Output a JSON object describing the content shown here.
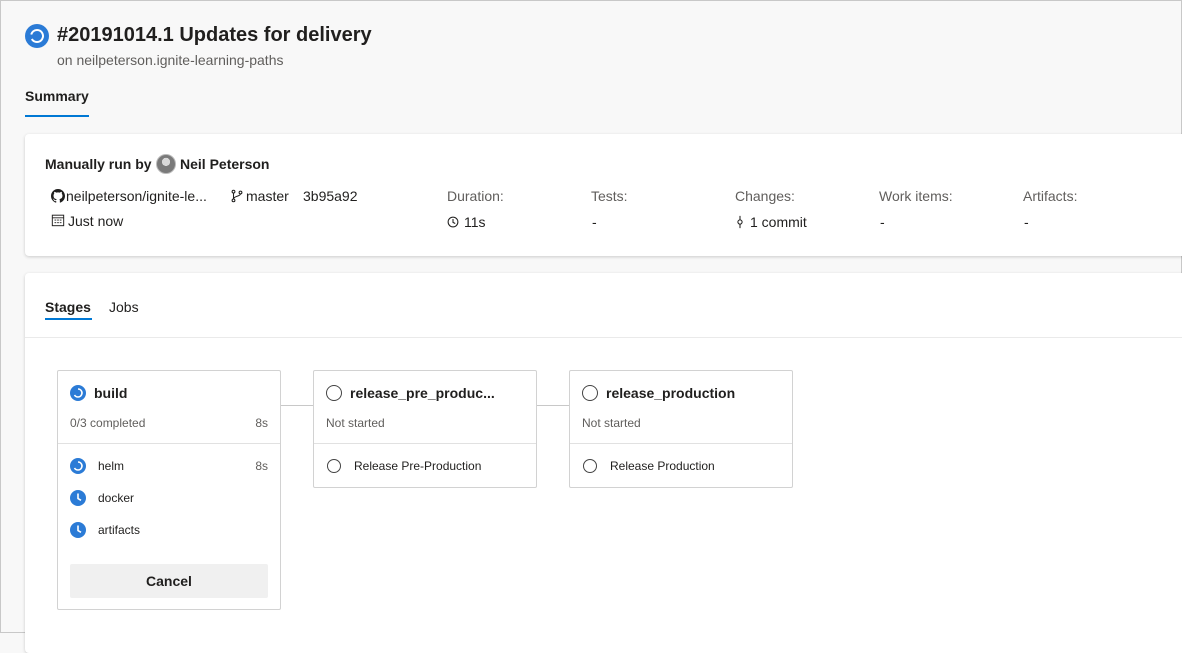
{
  "header": {
    "title": "#20191014.1 Updates for delivery",
    "subtitle": "on neilpeterson.ignite-learning-paths",
    "tab_summary": "Summary"
  },
  "summary": {
    "manually_run_by": "Manually run by",
    "author": "Neil Peterson",
    "repo": "neilpeterson/ignite-le...",
    "branch": "master",
    "commit": "3b95a92",
    "time": "Just now",
    "stats": [
      {
        "label": "Duration:",
        "value": "11s"
      },
      {
        "label": "Tests:",
        "value": "-"
      },
      {
        "label": "Changes:",
        "value": "1 commit"
      },
      {
        "label": "Work items:",
        "value": "-"
      },
      {
        "label": "Artifacts:",
        "value": "-"
      }
    ]
  },
  "stages_section": {
    "tabs": [
      "Stages",
      "Jobs"
    ],
    "stages": [
      {
        "name": "build",
        "status": "0/3 completed",
        "duration": "8s",
        "jobs": [
          {
            "name": "helm",
            "duration": "8s"
          },
          {
            "name": "docker",
            "duration": ""
          },
          {
            "name": "artifacts",
            "duration": ""
          }
        ],
        "cancel_label": "Cancel"
      },
      {
        "name": "release_pre_produc...",
        "status": "Not started",
        "jobs": [
          {
            "name": "Release Pre-Production"
          }
        ]
      },
      {
        "name": "release_production",
        "status": "Not started",
        "jobs": [
          {
            "name": "Release Production"
          }
        ]
      }
    ]
  },
  "colors": {
    "accent": "#0078d4",
    "running_icon": "#2b7bd6"
  },
  "icons": [
    "pipeline-run-icon",
    "github-icon",
    "branch-icon",
    "calendar-icon",
    "clock-icon",
    "commit-icon",
    "running-icon",
    "queued-icon",
    "not-started-icon"
  ]
}
